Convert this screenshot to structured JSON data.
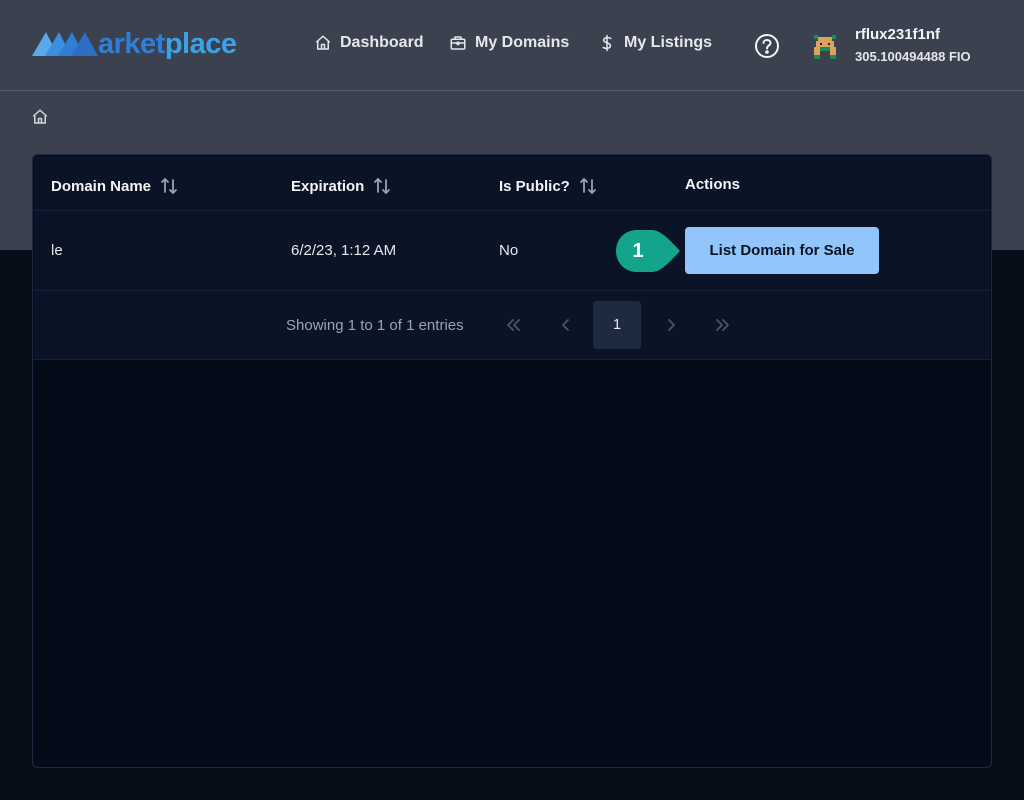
{
  "app": {
    "logo_part1": "arket",
    "logo_part2": "place"
  },
  "nav": {
    "dashboard": "Dashboard",
    "my_domains": "My Domains",
    "my_listings": "My Listings"
  },
  "user": {
    "name": "rflux231f1nf",
    "balance": "305.100494488 FIO"
  },
  "table": {
    "columns": [
      {
        "label": "Domain Name",
        "sortable": true
      },
      {
        "label": "Expiration",
        "sortable": true
      },
      {
        "label": "Is Public?",
        "sortable": true
      },
      {
        "label": "Actions",
        "sortable": false
      }
    ],
    "rows": [
      {
        "domain": "le",
        "expiration": "6/2/23, 1:12 AM",
        "is_public": "No",
        "action_label": "List Domain for Sale"
      }
    ]
  },
  "callout": {
    "number": "1",
    "color": "#14a38b"
  },
  "pagination": {
    "info": "Showing 1 to 1 of 1 entries",
    "current_page": "1"
  },
  "colors": {
    "header_bg": "#3b414e",
    "page_bg": "#070c19",
    "button_bg": "#93c5fd",
    "logo_blue": "#2f7fd6",
    "logo_light_blue": "#3aa3e6"
  }
}
